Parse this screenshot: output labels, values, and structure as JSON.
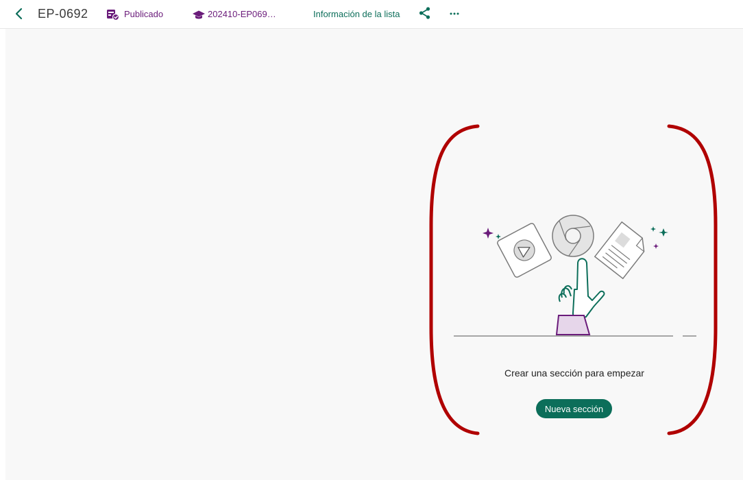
{
  "header": {
    "title": "EP-0692",
    "status_label": "Publicado",
    "course_label": "202410-EP069…",
    "info_link_label": "Información de la lista",
    "icons": {
      "back": "chevron-left-icon",
      "status": "published-calendar-icon",
      "course": "graduation-cap-icon",
      "share": "share-icon",
      "more": "more-horizontal-icon"
    }
  },
  "empty_state": {
    "message": "Crear una sección para empezar",
    "button_label": "Nueva sección"
  },
  "colors": {
    "accent_green": "#0c6e5a",
    "accent_purple": "#6a1b7a",
    "annotation_red": "#b00000"
  }
}
